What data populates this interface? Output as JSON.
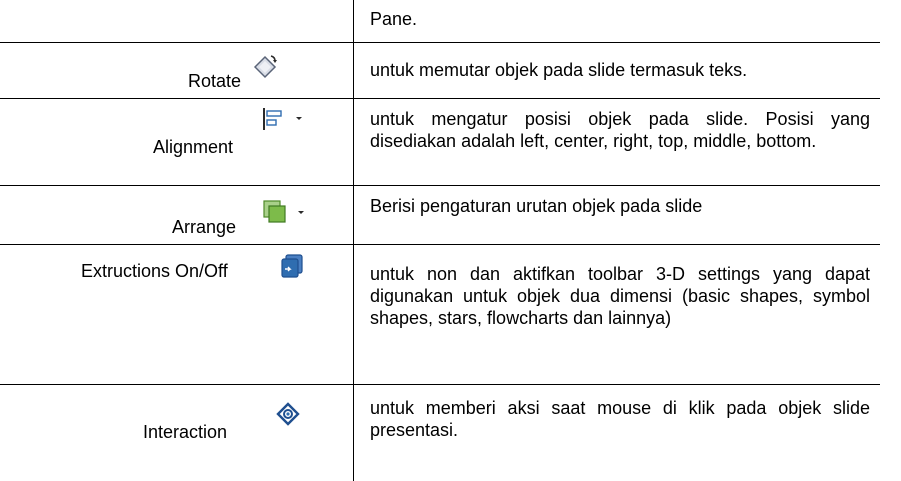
{
  "rows": [
    {
      "label": "",
      "icon": "",
      "description": "Pane."
    },
    {
      "label": "Rotate",
      "icon": "rotate-icon",
      "description": "untuk memutar objek pada slide termasuk teks."
    },
    {
      "label": "Alignment",
      "icon": "align-left-dropdown-icon",
      "description": "untuk mengatur posisi objek pada slide. Posisi yang disediakan adalah left, center, right, top, middle, bottom."
    },
    {
      "label": "Arrange",
      "icon": "arrange-dropdown-icon",
      "description": "Berisi pengaturan urutan objek pada slide"
    },
    {
      "label": "Extructions On/Off",
      "icon": "3d-extrusion-icon",
      "description": "untuk non dan aktifkan toolbar 3-D settings yang dapat digunakan untuk objek dua dimensi (basic shapes, symbol shapes, stars, flowcharts dan lainnya)"
    },
    {
      "label": "Interaction",
      "icon": "interaction-icon",
      "description": "untuk memberi aksi saat mouse di klik pada objek slide presentasi."
    }
  ],
  "colors": {
    "border": "#000000",
    "icon_green": "#7dbb4a",
    "icon_blue": "#2f6db0"
  }
}
